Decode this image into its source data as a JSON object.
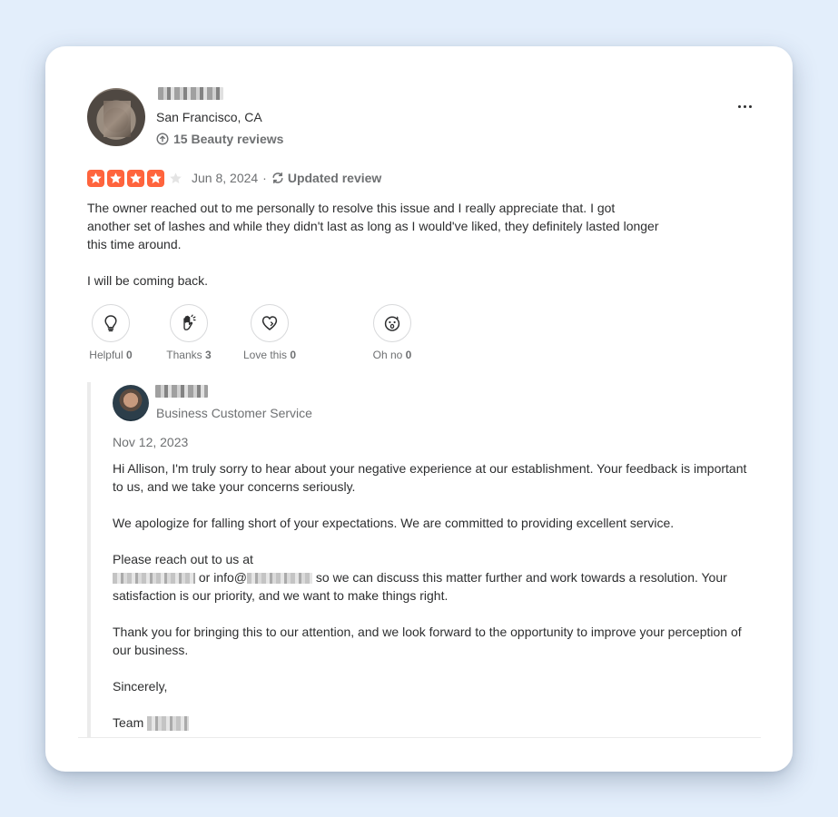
{
  "reviewer": {
    "location": "San Francisco, CA",
    "review_count": "15 Beauty reviews"
  },
  "review": {
    "rating": 4,
    "rating_max": 5,
    "date": "Jun 8, 2024",
    "separator": "·",
    "status": "Updated review",
    "paragraph_1": "The owner reached out to me personally to resolve this issue and I really appreciate that. I got another set of lashes and while they didn't last as long as I would've liked, they definitely lasted longer this time around.",
    "paragraph_2": "I will be coming back."
  },
  "reactions": [
    {
      "label": "Helpful",
      "count": "0",
      "icon": "lightbulb-icon"
    },
    {
      "label": "Thanks",
      "count": "3",
      "icon": "clapping-hands-icon"
    },
    {
      "label": "Love this",
      "count": "0",
      "icon": "heart-icon"
    },
    {
      "label": "Oh no",
      "count": "0",
      "icon": "shocked-face-icon"
    }
  ],
  "owner_reply": {
    "role": "Business Customer Service",
    "date": "Nov 12, 2023",
    "paragraph_1": "Hi Allison, I'm truly sorry to hear about your negative experience at our establishment. Your feedback is important to us, and we take your concerns seriously.",
    "paragraph_2": "We apologize for falling short of your expectations. We are committed to providing excellent service.",
    "contact_intro": "Please reach out to us at",
    "contact_or": " or info@",
    "contact_rest": " so we can discuss this matter further and work towards a resolution. Your satisfaction is our priority, and we want to make things right.",
    "paragraph_4": "Thank you for bringing this to our attention, and we look forward to the opportunity to improve your perception of our business.",
    "closing": "Sincerely,",
    "signature": "Team"
  },
  "colors": {
    "page_background": "#e3eefb",
    "star_active": "#ff643d",
    "star_inactive": "#ffffff",
    "muted_text": "#6e7072"
  }
}
